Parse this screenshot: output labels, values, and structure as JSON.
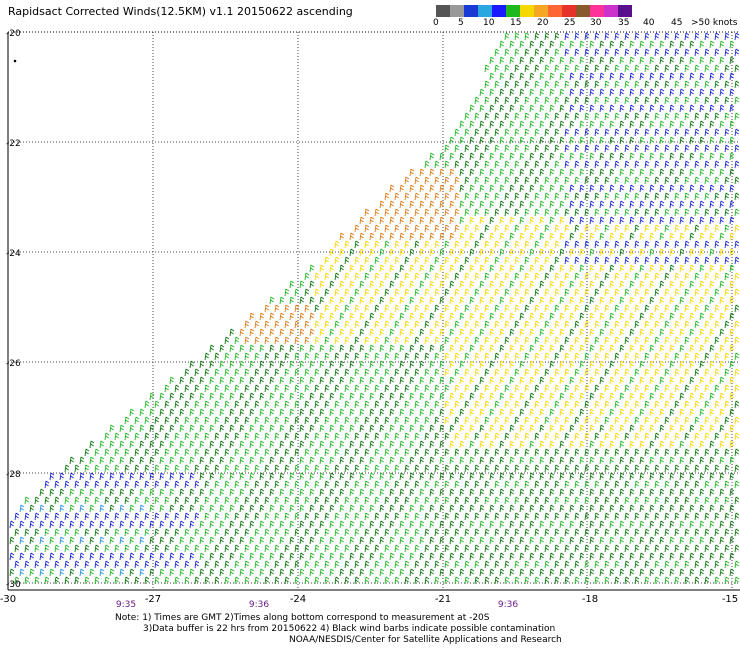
{
  "title": "Rapidsact Corrected Winds(12.5KM) v1.1 20150622 ascending",
  "legend": {
    "colors": [
      "#555555",
      "#999999",
      "#1a3ad6",
      "#2aa6e0",
      "#1a1aff",
      "#1fb81f",
      "#f5d800",
      "#f5a623",
      "#ff6633",
      "#e63329",
      "#8b5a2b",
      "#ff3399",
      "#cc33cc",
      "#5a0f8c"
    ],
    "labels": [
      "0",
      "5",
      "10",
      "15",
      "20",
      "25",
      "30",
      "35",
      "40",
      "45",
      ">50 knots"
    ]
  },
  "map": {
    "y_labels": [
      "-20",
      "-22",
      "-24",
      "-26",
      "-28",
      "-30"
    ],
    "x_labels": [
      "-30",
      "-27",
      "-24",
      "-21",
      "-18",
      "-15"
    ],
    "time_labels": [
      "9:35",
      "9:36",
      "9:36"
    ],
    "wind_colors": {
      "dark_green": "#0b7a0b",
      "green": "#22b622",
      "blue": "#1a2ad6",
      "light_blue": "#2a8fe0",
      "yellow": "#ffd600",
      "orange": "#e07b1a"
    }
  },
  "footer": {
    "line1": "Note: 1) Times are GMT 2)Times along bottom correspond to measurement at -20S",
    "line2": "3)Data buffer is 22 hrs from 20150622 4) Black wind barbs indicate possible contamination",
    "line3": "NOAA/NESDIS/Center for Satellite Applications and Research"
  }
}
